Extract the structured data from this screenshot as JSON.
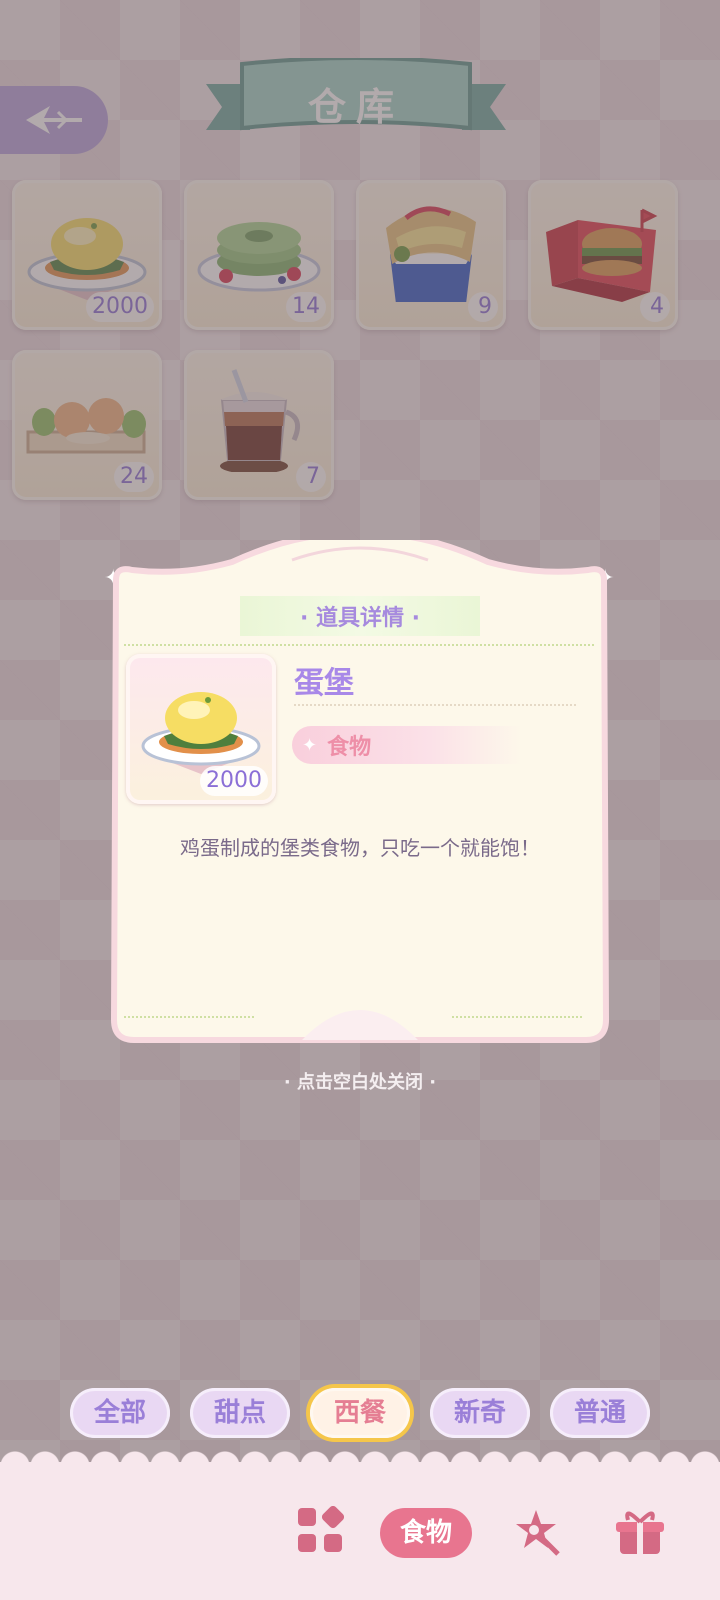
{
  "header": {
    "title": "仓库",
    "back_icon": "back-arrow-icon"
  },
  "inventory": [
    {
      "name": "egg-burger",
      "icon": "egg-burger-icon",
      "count": "2000"
    },
    {
      "name": "matcha-pancake",
      "icon": "matcha-pancake-icon",
      "count": "14"
    },
    {
      "name": "hotdog-box",
      "icon": "hotdog-box-icon",
      "count": "9"
    },
    {
      "name": "burger-box",
      "icon": "burger-box-icon",
      "count": "4"
    },
    {
      "name": "bread-platter",
      "icon": "bread-platter-icon",
      "count": "24"
    },
    {
      "name": "iced-coffee",
      "icon": "iced-coffee-icon",
      "count": "7"
    }
  ],
  "detail": {
    "title": "· 道具详情 ·",
    "item_name": "蛋堡",
    "category": "食物",
    "count": "2000",
    "description": "鸡蛋制成的堡类食物，只吃一个就能饱！",
    "close_hint": "· 点击空白处关闭 ·"
  },
  "filters": [
    {
      "label": "全部",
      "active": false
    },
    {
      "label": "甜点",
      "active": false
    },
    {
      "label": "西餐",
      "active": true
    },
    {
      "label": "新奇",
      "active": false
    },
    {
      "label": "普通",
      "active": false
    }
  ],
  "bottom_nav": {
    "grid_icon": "grid-icon",
    "food_label": "食物",
    "tool_icon": "magic-wand-icon",
    "gift_icon": "gift-box-icon"
  },
  "colors": {
    "accent_purple": "#a888e8",
    "accent_pink": "#e8758f",
    "active_outline": "#f5c64a"
  }
}
